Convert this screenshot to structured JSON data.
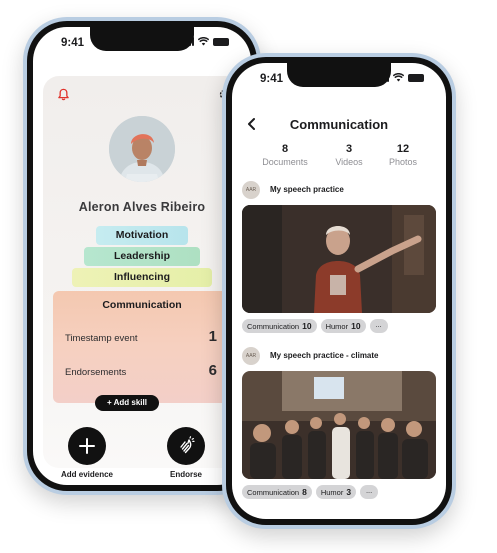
{
  "profile_screen": {
    "status_time": "9:41",
    "person_name": "Aleron Alves Ribeiro",
    "skills": [
      "Motivation",
      "Leadership",
      "Influencing"
    ],
    "active_skill": {
      "title": "Communication",
      "stats": [
        {
          "label": "Timestamp event",
          "value": "1"
        },
        {
          "label": "Endorsements",
          "value": "6"
        }
      ]
    },
    "add_skill_label": "Add skill",
    "actions": {
      "add_evidence": "Add evidence",
      "endorse": "Endorse"
    },
    "icons": {
      "bell": "bell-icon",
      "gear": "gear-icon",
      "plus": "plus-icon",
      "clap": "clap-icon"
    },
    "colors": {
      "motivation": "#bfe8ee",
      "leadership": "#b3e3c8",
      "influencing": "#e9f1a9",
      "communication": "#f4c8b0"
    }
  },
  "detail_screen": {
    "status_time": "9:41",
    "title": "Communication",
    "counts": [
      {
        "number": "8",
        "label": "Documents"
      },
      {
        "number": "3",
        "label": "Videos"
      },
      {
        "number": "12",
        "label": "Photos"
      }
    ],
    "posts": [
      {
        "avatar_initials": "AAR",
        "title": "My speech practice",
        "tags": [
          {
            "label": "Communication",
            "count": "10"
          },
          {
            "label": "Humor",
            "count": "10"
          }
        ],
        "more": "..."
      },
      {
        "avatar_initials": "AAR",
        "title": "My speech practice - climate",
        "tags": [
          {
            "label": "Communication",
            "count": "8"
          },
          {
            "label": "Humor",
            "count": "3"
          }
        ],
        "more": "..."
      }
    ]
  }
}
